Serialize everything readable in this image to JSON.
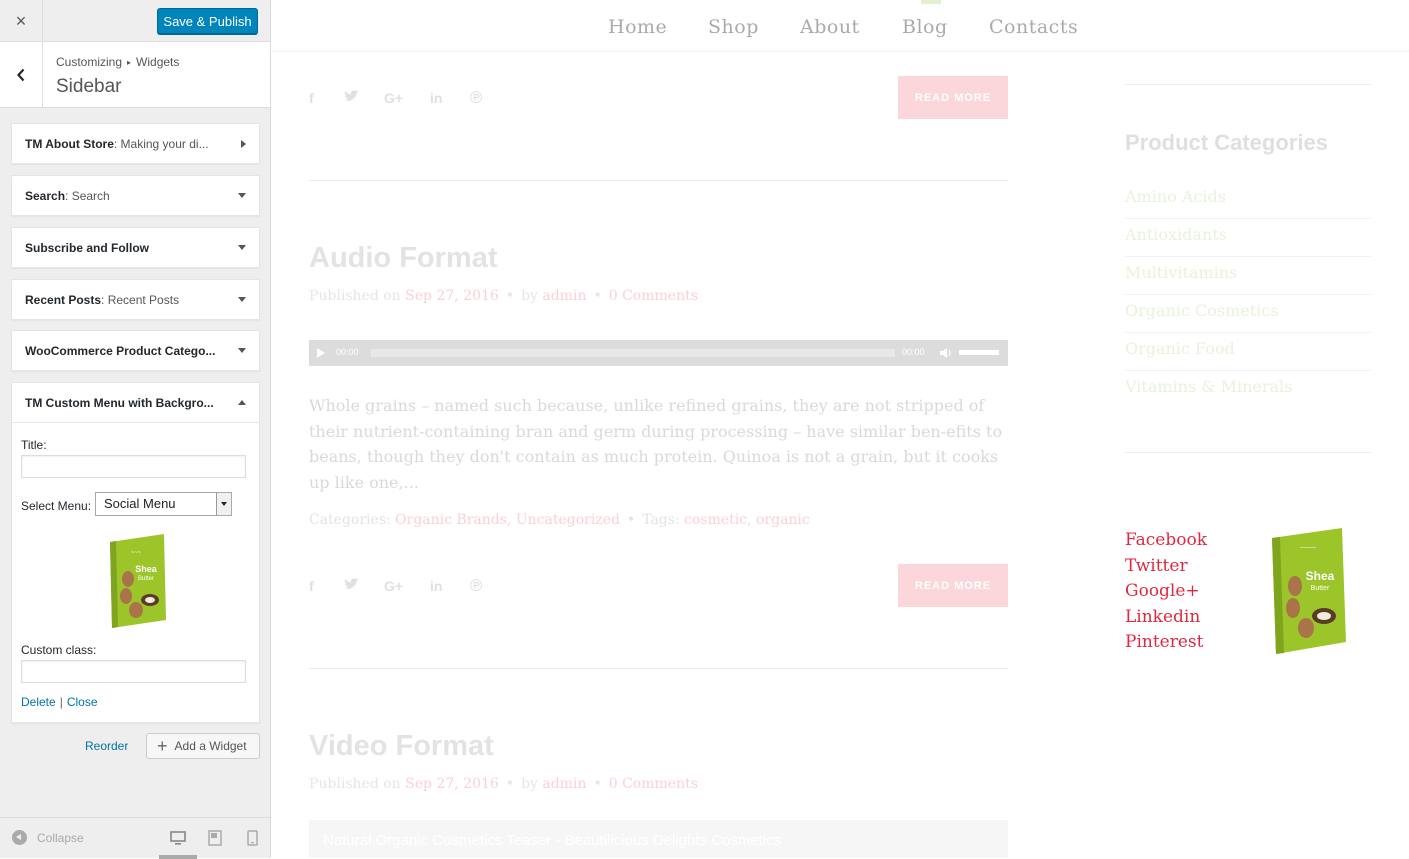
{
  "customizer": {
    "close_glyph": "×",
    "save_label": "Save & Publish",
    "breadcrumb": [
      "Customizing",
      "Widgets"
    ],
    "breadcrumb_sep": "▸",
    "section_title": "Sidebar",
    "widgets": [
      {
        "title": "TM About Store",
        "instance": ": Making your di..."
      },
      {
        "title": "Search",
        "instance": ": Search"
      },
      {
        "title": "Subscribe and Follow",
        "instance": ""
      },
      {
        "title": "Recent Posts",
        "instance": ": Recent Posts"
      },
      {
        "title": "WooCommerce Product Catego...",
        "instance": ""
      },
      {
        "title": "TM Custom Menu with Backgro...",
        "instance": ""
      }
    ],
    "expanded_widget": {
      "title_label": "Title:",
      "title_value": "",
      "select_menu_label": "Select Menu:",
      "select_menu_value": "Social Menu",
      "custom_class_label": "Custom class:",
      "custom_class_value": "",
      "delete_label": "Delete",
      "pipe": "|",
      "close_label": "Close"
    },
    "reorder_label": "Reorder",
    "add_widget_label": "Add a Widget",
    "add_widget_glyph": "+",
    "collapse_label": "Collapse"
  },
  "preview": {
    "nav": [
      "Home",
      "Shop",
      "About",
      "Blog",
      "Contacts"
    ],
    "read_more_label": "READ MORE",
    "share_icons": [
      "facebook-icon",
      "twitter-icon",
      "google-plus-icon",
      "linkedin-icon",
      "pinterest-icon"
    ],
    "share_glyphs": [
      "f",
      "🐦",
      "G+",
      "in",
      "℗"
    ],
    "posts": [
      {
        "title": "Audio Format",
        "meta_published": "Published on",
        "meta_date": "Sep 27, 2016",
        "meta_by": "by",
        "meta_author": "admin",
        "meta_comments": "0 Comments",
        "meta_dot": "•",
        "audio_time_start": "00:00",
        "audio_time_end": "00:00",
        "excerpt": "Whole grains – named such because, unlike refined grains, they are not stripped of their nutrient-containing bran and germ during processing – have similar ben-efits to beans, though they don't contain as much protein. Quinoa is not a grain, but it cooks up like one,...",
        "categories_label": "Categories:",
        "categories": "Organic Brands, Uncategorized",
        "tags_label": "Tags:",
        "tags": "cosmetic, organic"
      },
      {
        "title": "Video Format",
        "meta_published": "Published on",
        "meta_date": "Sep 27, 2016",
        "meta_by": "by",
        "meta_author": "admin",
        "meta_comments": "0 Comments",
        "meta_dot": "•",
        "video_title": "Natural Organic Cosmetics Teaser - Beautilicious Delights Cosmetics"
      }
    ],
    "sidebar": {
      "product_categories_title": "Product Categories",
      "categories": [
        "Amino Acids",
        "Antioxidants",
        "Multivitamins",
        "Organic Cosmetics",
        "Organic Food",
        "Vitamins & Minerals"
      ],
      "social_menu": [
        "Facebook",
        "Twitter",
        "Google+",
        "Linkedin",
        "Pinterest"
      ],
      "book_label": "Shea Butter"
    }
  },
  "colors": {
    "wp_blue": "#0085ba",
    "link_blue": "#0073aa",
    "read_more_bg": "#fbd7dc",
    "social_red": "#e0283f",
    "book_green": "#9cc52a"
  }
}
